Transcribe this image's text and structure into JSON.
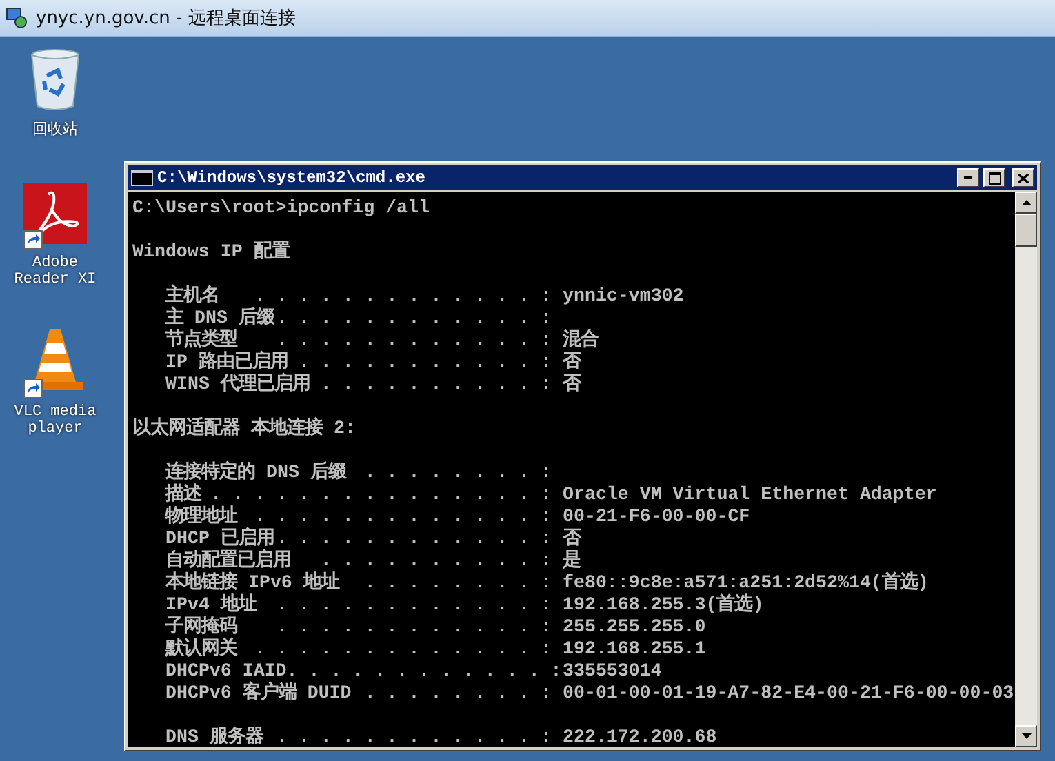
{
  "window": {
    "title": "ynyc.yn.gov.cn - 远程桌面连接"
  },
  "desktop_icons": [
    {
      "kind": "recycle-bin",
      "label": "回收站",
      "shortcut": false
    },
    {
      "kind": "pdf-reader",
      "label": "Adobe Reader XI",
      "shortcut": true
    },
    {
      "kind": "traffic-cone",
      "label": "VLC media player",
      "shortcut": true
    }
  ],
  "console": {
    "title": "C:\\Windows\\system32\\cmd.exe",
    "lines": [
      {
        "kind": "text",
        "text": "C:\\Users\\root>ipconfig /all"
      },
      {
        "kind": "blank"
      },
      {
        "kind": "text",
        "text": "Windows IP 配置"
      },
      {
        "kind": "blank"
      },
      {
        "kind": "entry",
        "label": "主机名",
        "leader": ". . . . . . . . . . . . . :",
        "value": "ynnic-vm302"
      },
      {
        "kind": "entry",
        "label": "主 DNS 后缀",
        "leader": ". . . . . . . . . . . . :"
      },
      {
        "kind": "entry",
        "label": "节点类型",
        "leader": ". . . . . . . . . . . . :",
        "value": "混合"
      },
      {
        "kind": "entry",
        "label": "IP 路由已启用",
        "leader": ". . . . . . . . . . . :",
        "value": "否"
      },
      {
        "kind": "entry",
        "label": "WINS 代理已启用",
        "leader": ". . . . . . . . . . :",
        "value": "否"
      },
      {
        "kind": "blank"
      },
      {
        "kind": "text",
        "text": "以太网适配器 本地连接 2:"
      },
      {
        "kind": "blank"
      },
      {
        "kind": "entry",
        "label": "连接特定的 DNS 后缀",
        "leader": ". . . . . . . . :"
      },
      {
        "kind": "entry",
        "label": "描述",
        "leader": ". . . . . . . . . . . . . . . :",
        "value": "Oracle VM Virtual Ethernet Adapter"
      },
      {
        "kind": "entry",
        "label": "物理地址",
        "leader": ". . . . . . . . . . . . . :",
        "value": "00-21-F6-00-00-CF"
      },
      {
        "kind": "entry",
        "label": "DHCP 已启用",
        "leader": ". . . . . . . . . . . . :",
        "value": "否"
      },
      {
        "kind": "entry",
        "label": "自动配置已启用",
        "leader": ". . . . . . . . . . :",
        "value": "是"
      },
      {
        "kind": "entry",
        "label": "本地链接 IPv6 地址",
        "leader": ". . . . . . . . :",
        "value": "fe80::9c8e:a571:a251:2d52%14(首选)"
      },
      {
        "kind": "entry",
        "label": "IPv4 地址",
        "leader": ". . . . . . . . . . . . :",
        "value": "192.168.255.3(首选)"
      },
      {
        "kind": "entry",
        "label": "子网掩码",
        "leader": ". . . . . . . . . . . . :",
        "value": "255.255.255.0"
      },
      {
        "kind": "entry",
        "label": "默认网关",
        "leader": ". . . . . . . . . . . . . :",
        "value": "192.168.255.1"
      },
      {
        "kind": "entry",
        "label": "DHCPv6 IAID",
        "leader": ". . . . . . . . . . . . :",
        "value": "335553014"
      },
      {
        "kind": "entry",
        "label": "DHCPv6 客户端 DUID",
        "leader": ". . . . . . . . :",
        "value": "00-01-00-01-19-A7-82-E4-00-21-F6-00-00-03"
      },
      {
        "kind": "blank"
      },
      {
        "kind": "entry",
        "label": "DNS 服务器",
        "leader": ". . . . . . . . . . . . :",
        "value": "222.172.200.68"
      }
    ]
  }
}
